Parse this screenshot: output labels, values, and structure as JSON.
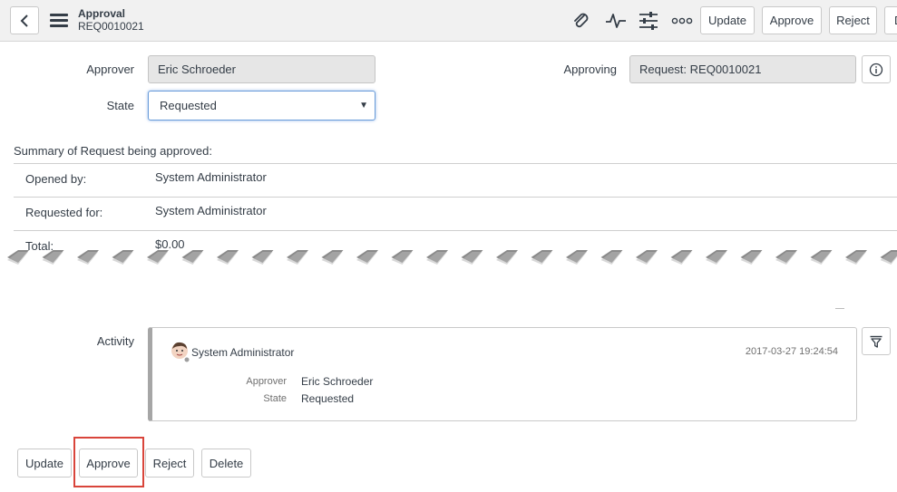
{
  "header": {
    "title": "Approval",
    "number": "REQ0010021",
    "icons": [
      "back-chevron-icon",
      "hamburger-menu-icon",
      "paperclip-icon",
      "activity-pulse-icon",
      "sliders-icon",
      "more-dots-icon"
    ],
    "buttons": {
      "update": "Update",
      "approve": "Approve",
      "reject": "Reject",
      "cut_off": "D"
    }
  },
  "form": {
    "approver_label": "Approver",
    "approver_value": "Eric Schroeder",
    "state_label": "State",
    "state_value": "Requested",
    "approving_label": "Approving",
    "approving_value": "Request: REQ0010021"
  },
  "summary": {
    "title": "Summary of Request being approved:",
    "rows": [
      {
        "label": "Opened by:",
        "value": "System Administrator"
      },
      {
        "label": "Requested for:",
        "value": "System Administrator"
      },
      {
        "label": "Total:",
        "value": "$0.00"
      }
    ]
  },
  "activity": {
    "label": "Activity",
    "user": "System Administrator",
    "timestamp": "2017-03-27 19:24:54",
    "fields": [
      {
        "label": "Approver",
        "value": "Eric Schroeder"
      },
      {
        "label": "State",
        "value": "Requested"
      }
    ]
  },
  "footer_buttons": {
    "update": "Update",
    "approve": "Approve",
    "reject": "Reject",
    "delete": "Delete"
  },
  "colors": {
    "highlight": "#d9453b",
    "header_bg": "#f1f1f1",
    "readonly_bg": "#e6e6e6",
    "focus_border": "#6a9cd9"
  }
}
